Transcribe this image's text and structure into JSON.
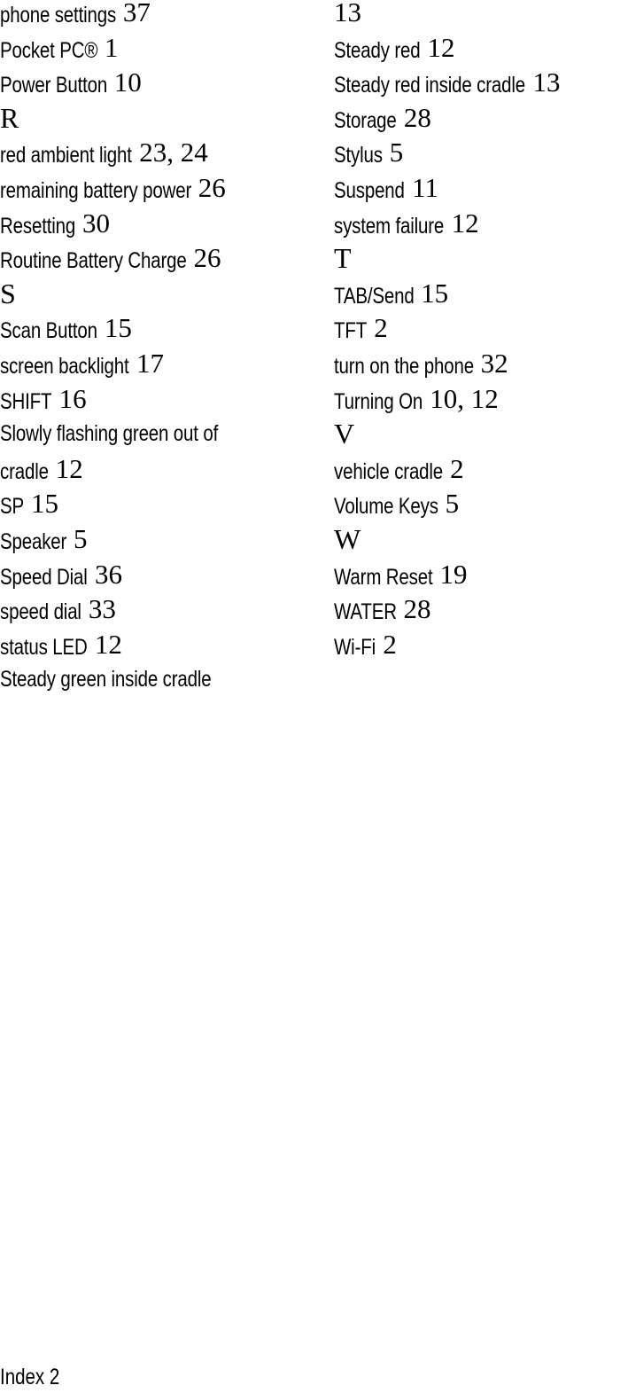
{
  "document": {
    "left_column": [
      {
        "type": "entry",
        "term": "phone settings",
        "pages": "37"
      },
      {
        "type": "entry",
        "term": "Pocket PC®",
        "pages": "1"
      },
      {
        "type": "entry",
        "term": "Power Button",
        "pages": "10"
      },
      {
        "type": "letter",
        "letter": "R"
      },
      {
        "type": "entry",
        "term": "red ambient light",
        "pages": "23, 24"
      },
      {
        "type": "entry",
        "term": "remaining battery power",
        "pages": "26"
      },
      {
        "type": "entry",
        "term": "Resetting",
        "pages": "30"
      },
      {
        "type": "entry",
        "term": "Routine Battery Charge",
        "pages": "26"
      },
      {
        "type": "letter",
        "letter": "S"
      },
      {
        "type": "entry",
        "term": "Scan Button",
        "pages": "15"
      },
      {
        "type": "entry",
        "term": "screen backlight",
        "pages": "17"
      },
      {
        "type": "entry",
        "term": "SHIFT",
        "pages": "16"
      },
      {
        "type": "entry",
        "term": "Slowly flashing green out of",
        "pages": ""
      },
      {
        "type": "entry",
        "term": "cradle",
        "pages": "12"
      },
      {
        "type": "entry",
        "term": "SP",
        "pages": "15"
      },
      {
        "type": "entry",
        "term": "Speaker",
        "pages": "5"
      },
      {
        "type": "entry",
        "term": "Speed Dial",
        "pages": "36"
      },
      {
        "type": "entry",
        "term": "speed dial",
        "pages": "33"
      },
      {
        "type": "entry",
        "term": "status LED",
        "pages": "12"
      },
      {
        "type": "entry",
        "term": "Steady green inside cradle",
        "pages": ""
      }
    ],
    "right_column": [
      {
        "type": "entry",
        "term": "",
        "pages": "13"
      },
      {
        "type": "entry",
        "term": "Steady red",
        "pages": "12"
      },
      {
        "type": "entry",
        "term": "Steady red inside cradle",
        "pages": "13"
      },
      {
        "type": "entry",
        "term": "Storage",
        "pages": "28"
      },
      {
        "type": "entry",
        "term": "Stylus",
        "pages": "5"
      },
      {
        "type": "entry",
        "term": "Suspend",
        "pages": "11"
      },
      {
        "type": "entry",
        "term": "system failure",
        "pages": "12"
      },
      {
        "type": "letter",
        "letter": "T"
      },
      {
        "type": "entry",
        "term": "TAB/Send",
        "pages": "15"
      },
      {
        "type": "entry",
        "term": "TFT",
        "pages": "2"
      },
      {
        "type": "entry",
        "term": "turn on the phone",
        "pages": "32"
      },
      {
        "type": "entry",
        "term": "Turning On",
        "pages": "10, 12"
      },
      {
        "type": "letter",
        "letter": "V"
      },
      {
        "type": "entry",
        "term": "vehicle cradle",
        "pages": "2"
      },
      {
        "type": "entry",
        "term": "Volume Keys",
        "pages": "5"
      },
      {
        "type": "letter",
        "letter": "W"
      },
      {
        "type": "entry",
        "term": "Warm Reset",
        "pages": "19"
      },
      {
        "type": "entry",
        "term": "WATER",
        "pages": "28"
      },
      {
        "type": "entry",
        "term": "Wi-Fi",
        "pages": "2"
      }
    ],
    "footer": "Index 2"
  }
}
